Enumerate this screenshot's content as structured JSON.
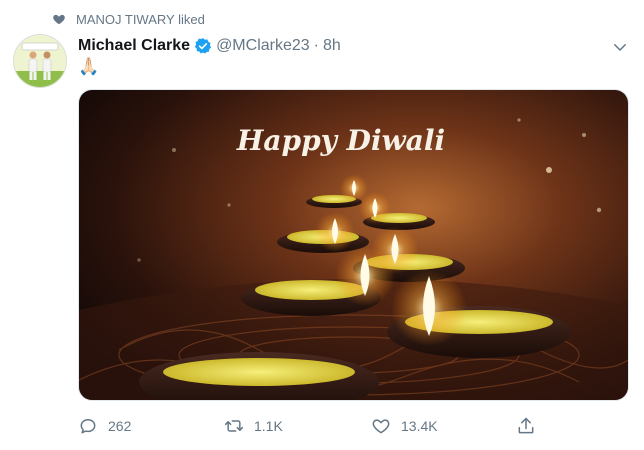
{
  "social_context": {
    "text": "MANOJ TIWARY liked"
  },
  "tweet": {
    "author_name": "Michael Clarke",
    "handle": "@MClarke23",
    "separator": "·",
    "time": "8h",
    "text_emoji": "🙏🏻",
    "image_caption": "Happy Diwali"
  },
  "actions": {
    "reply_count": "262",
    "retweet_count": "1.1K",
    "like_count": "13.4K"
  },
  "colors": {
    "verified": "#1da1f2",
    "muted": "#657786"
  }
}
